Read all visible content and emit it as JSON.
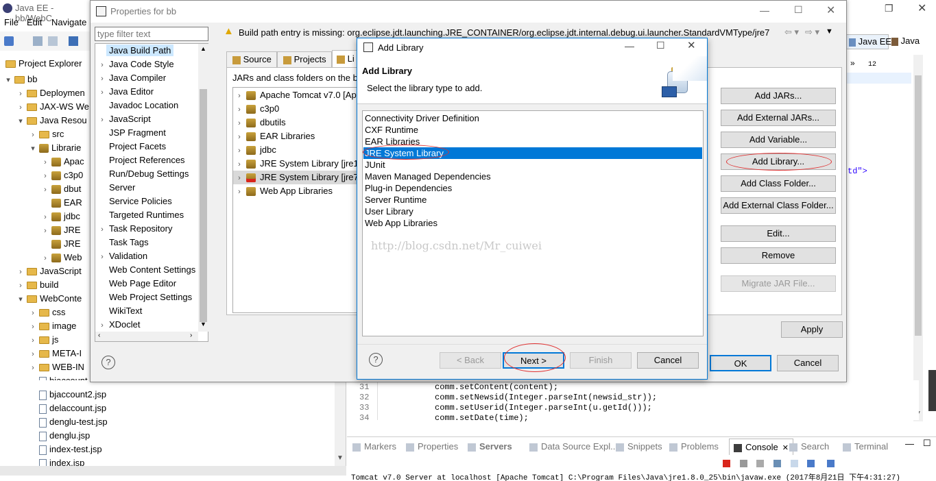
{
  "eclipse": {
    "title": "Java EE - bb/WebC",
    "menu": [
      "File",
      "Edit",
      "Navigate"
    ],
    "perspectives": [
      "Java EE",
      "Java"
    ],
    "project_explorer_title": "Project Explorer",
    "tree": [
      {
        "label": "bb",
        "indent": 0,
        "arrow": "▾",
        "icon": "project"
      },
      {
        "label": "Deploymen",
        "indent": 1,
        "arrow": "›",
        "icon": "deploy"
      },
      {
        "label": "JAX-WS We",
        "indent": 1,
        "arrow": "›",
        "icon": "ws"
      },
      {
        "label": "Java Resou",
        "indent": 1,
        "arrow": "▾",
        "icon": "javares"
      },
      {
        "label": "src",
        "indent": 2,
        "arrow": "›",
        "icon": "pkg"
      },
      {
        "label": "Librarie",
        "indent": 2,
        "arrow": "▾",
        "icon": "lib"
      },
      {
        "label": "Apac",
        "indent": 3,
        "arrow": "›",
        "icon": "jar"
      },
      {
        "label": "c3p0",
        "indent": 3,
        "arrow": "›",
        "icon": "jar"
      },
      {
        "label": "dbut",
        "indent": 3,
        "arrow": "›",
        "icon": "jar"
      },
      {
        "label": "EAR",
        "indent": 3,
        "arrow": "",
        "icon": "jar"
      },
      {
        "label": "jdbc",
        "indent": 3,
        "arrow": "›",
        "icon": "jar"
      },
      {
        "label": "JRE",
        "indent": 3,
        "arrow": "›",
        "icon": "jar"
      },
      {
        "label": "JRE",
        "indent": 3,
        "arrow": "",
        "icon": "jar"
      },
      {
        "label": "Web",
        "indent": 3,
        "arrow": "›",
        "icon": "jar"
      },
      {
        "label": "JavaScript",
        "indent": 1,
        "arrow": "›",
        "icon": "js"
      },
      {
        "label": "build",
        "indent": 1,
        "arrow": "›",
        "icon": "folder"
      },
      {
        "label": "WebConte",
        "indent": 1,
        "arrow": "▾",
        "icon": "folder"
      },
      {
        "label": "css",
        "indent": 2,
        "arrow": "›",
        "icon": "folder"
      },
      {
        "label": "image",
        "indent": 2,
        "arrow": "›",
        "icon": "folder"
      },
      {
        "label": "js",
        "indent": 2,
        "arrow": "›",
        "icon": "folder"
      },
      {
        "label": "META-I",
        "indent": 2,
        "arrow": "›",
        "icon": "folder"
      },
      {
        "label": "WEB-IN",
        "indent": 2,
        "arrow": "›",
        "icon": "folder"
      },
      {
        "label": "bjaccount.jsp",
        "indent": 2,
        "arrow": "",
        "icon": "file"
      },
      {
        "label": "bjaccount2.jsp",
        "indent": 2,
        "arrow": "",
        "icon": "file"
      },
      {
        "label": "delaccount.jsp",
        "indent": 2,
        "arrow": "",
        "icon": "file"
      },
      {
        "label": "denglu-test.jsp",
        "indent": 2,
        "arrow": "",
        "icon": "file"
      },
      {
        "label": "denglu.jsp",
        "indent": 2,
        "arrow": "",
        "icon": "file"
      },
      {
        "label": "index-test.jsp",
        "indent": 2,
        "arrow": "",
        "icon": "file"
      },
      {
        "label": "index.jsp",
        "indent": 2,
        "arrow": "",
        "icon": "file"
      }
    ],
    "editor_right": {
      "tab_count": "12",
      "snippet": "td\">"
    },
    "code": [
      {
        "ln": "31",
        "text": "comm.setContent(content);"
      },
      {
        "ln": "32",
        "text": "comm.setNewsid(Integer.parseInt(newsid_str));"
      },
      {
        "ln": "33",
        "text": "comm.setUserid(Integer.parseInt(u.getId()));"
      },
      {
        "ln": "34",
        "text": "comm.setDate(time);"
      }
    ],
    "bottom_tabs": [
      "Markers",
      "Properties",
      "Servers",
      "Data Source Expl...",
      "Snippets",
      "Problems",
      "Console",
      "Search",
      "Terminal"
    ],
    "console_text": "Tomcat v7.0 Server at localhost [Apache Tomcat] C:\\Program Files\\Java\\jre1.8.0_25\\bin\\javaw.exe (2017年8月21日 下午4:31:27)"
  },
  "properties": {
    "title": "Properties for bb",
    "filter_placeholder": "type filter text",
    "nav": [
      {
        "label": "Java Build Path",
        "arrow": "",
        "selected": true
      },
      {
        "label": "Java Code Style",
        "arrow": "›"
      },
      {
        "label": "Java Compiler",
        "arrow": "›"
      },
      {
        "label": "Java Editor",
        "arrow": "›"
      },
      {
        "label": "Javadoc Location",
        "arrow": ""
      },
      {
        "label": "JavaScript",
        "arrow": "›"
      },
      {
        "label": "JSP Fragment",
        "arrow": ""
      },
      {
        "label": "Project Facets",
        "arrow": ""
      },
      {
        "label": "Project References",
        "arrow": ""
      },
      {
        "label": "Run/Debug Settings",
        "arrow": ""
      },
      {
        "label": "Server",
        "arrow": ""
      },
      {
        "label": "Service Policies",
        "arrow": ""
      },
      {
        "label": "Targeted Runtimes",
        "arrow": ""
      },
      {
        "label": "Task Repository",
        "arrow": "›"
      },
      {
        "label": "Task Tags",
        "arrow": ""
      },
      {
        "label": "Validation",
        "arrow": "›"
      },
      {
        "label": "Web Content Settings",
        "arrow": ""
      },
      {
        "label": "Web Page Editor",
        "arrow": ""
      },
      {
        "label": "Web Project Settings",
        "arrow": ""
      },
      {
        "label": "WikiText",
        "arrow": ""
      },
      {
        "label": "XDoclet",
        "arrow": "›"
      }
    ],
    "warning": "Build path entry is missing: org.eclipse.jdt.launching.JRE_CONTAINER/org.eclipse.jdt.internal.debug.ui.launcher.StandardVMType/jre7",
    "tabs": [
      "Source",
      "Projects",
      "Li"
    ],
    "jars_label": "JARs and class folders on the bb",
    "libs": [
      {
        "label": "Apache Tomcat v7.0 [Ap",
        "sel": false,
        "err": false
      },
      {
        "label": "c3p0",
        "sel": false,
        "err": false
      },
      {
        "label": "dbutils",
        "sel": false,
        "err": false
      },
      {
        "label": "EAR Libraries",
        "sel": false,
        "err": false
      },
      {
        "label": "jdbc",
        "sel": false,
        "err": false
      },
      {
        "label": "JRE System Library [jre1",
        "sel": false,
        "err": false
      },
      {
        "label": "JRE System Library [jre7",
        "sel": true,
        "err": true
      },
      {
        "label": "Web App Libraries",
        "sel": false,
        "err": false
      }
    ],
    "buttons": {
      "add_jars": "Add JARs...",
      "add_ext_jars": "Add External JARs...",
      "add_var": "Add Variable...",
      "add_lib": "Add Library...",
      "add_class": "Add Class Folder...",
      "add_ext_class": "Add External Class Folder...",
      "edit": "Edit...",
      "remove": "Remove",
      "migrate": "Migrate JAR File...",
      "apply": "Apply",
      "ok": "OK",
      "cancel": "Cancel"
    }
  },
  "dialog": {
    "title": "Add Library",
    "heading": "Add Library",
    "subtitle": "Select the library type to add.",
    "items": [
      "Connectivity Driver Definition",
      "CXF Runtime",
      "EAR Libraries",
      "JRE System Library",
      "JUnit",
      "Maven Managed Dependencies",
      "Plug-in Dependencies",
      "Server Runtime",
      "User Library",
      "Web App Libraries"
    ],
    "selected_index": 3,
    "watermark": "http://blog.csdn.net/Mr_cuiwei",
    "buttons": {
      "back": "< Back",
      "next": "Next >",
      "finish": "Finish",
      "cancel": "Cancel"
    }
  },
  "colors": {
    "selection": "#0078d7",
    "highlight_circle": "#e03030",
    "selected_nav": "#cce8ff"
  }
}
